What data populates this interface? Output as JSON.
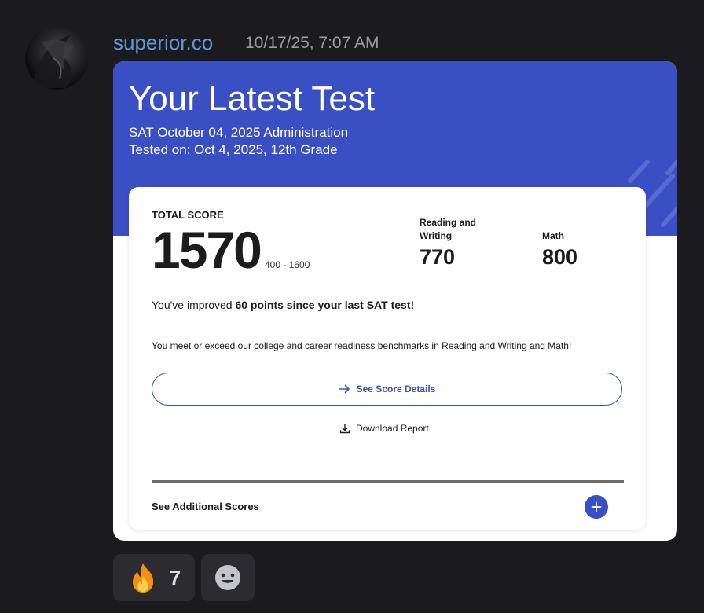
{
  "message": {
    "author": "superior.co",
    "timestamp": "10/17/25, 7:07 AM"
  },
  "embed": {
    "title": "Your Latest Test",
    "subtitle_line1": "SAT October 04, 2025 Administration",
    "subtitle_line2": "Tested on: Oct 4, 2025, 12th Grade",
    "accent_color": "#3a4fc4",
    "card": {
      "total_label": "TOTAL SCORE",
      "total_score": "1570",
      "score_range": "400 - 1600",
      "sections": [
        {
          "label": "Reading and Writing",
          "score": "770"
        },
        {
          "label": "Math",
          "score": "800"
        }
      ],
      "improved_prefix": "You've improved ",
      "improved_bold": "60 points since your last SAT test!",
      "benchmark_text": "You meet or exceed our college and career readiness benchmarks in Reading and Writing and Math!",
      "see_details_label": "See Score Details",
      "download_label": "Download Report",
      "additional_label": "See Additional Scores"
    }
  },
  "reactions": [
    {
      "emoji": "fire-emoji",
      "count": "7"
    },
    {
      "emoji": "add-reaction-icon"
    }
  ]
}
